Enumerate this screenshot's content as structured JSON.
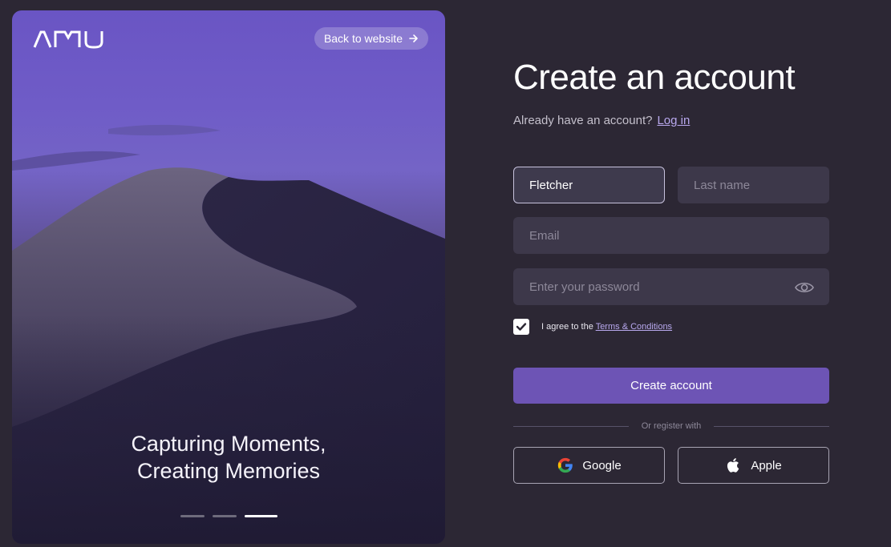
{
  "hero": {
    "logo_text": "AMU",
    "back_label": "Back to website",
    "tagline_line1": "Capturing Moments,",
    "tagline_line2": "Creating Memories",
    "slides": 3,
    "active_slide": 3
  },
  "form": {
    "title": "Create an account",
    "login_prompt": "Already have an account?",
    "login_link": "Log in",
    "first_name_value": "Fletcher",
    "last_name_placeholder": "Last name",
    "email_placeholder": "Email",
    "password_placeholder": "Enter your password",
    "agree_text": "I agree to the",
    "terms_link": "Terms & Conditions",
    "agree_checked": true,
    "submit_label": "Create account",
    "divider_text": "Or register with",
    "google_label": "Google",
    "apple_label": "Apple"
  },
  "colors": {
    "background": "#2c2734",
    "accent": "#6d54b5",
    "link": "#b9a9ef",
    "field_bg": "#3d384a"
  },
  "icons": [
    "arrow-right-icon",
    "eye-icon",
    "check-icon",
    "google-icon",
    "apple-icon"
  ]
}
